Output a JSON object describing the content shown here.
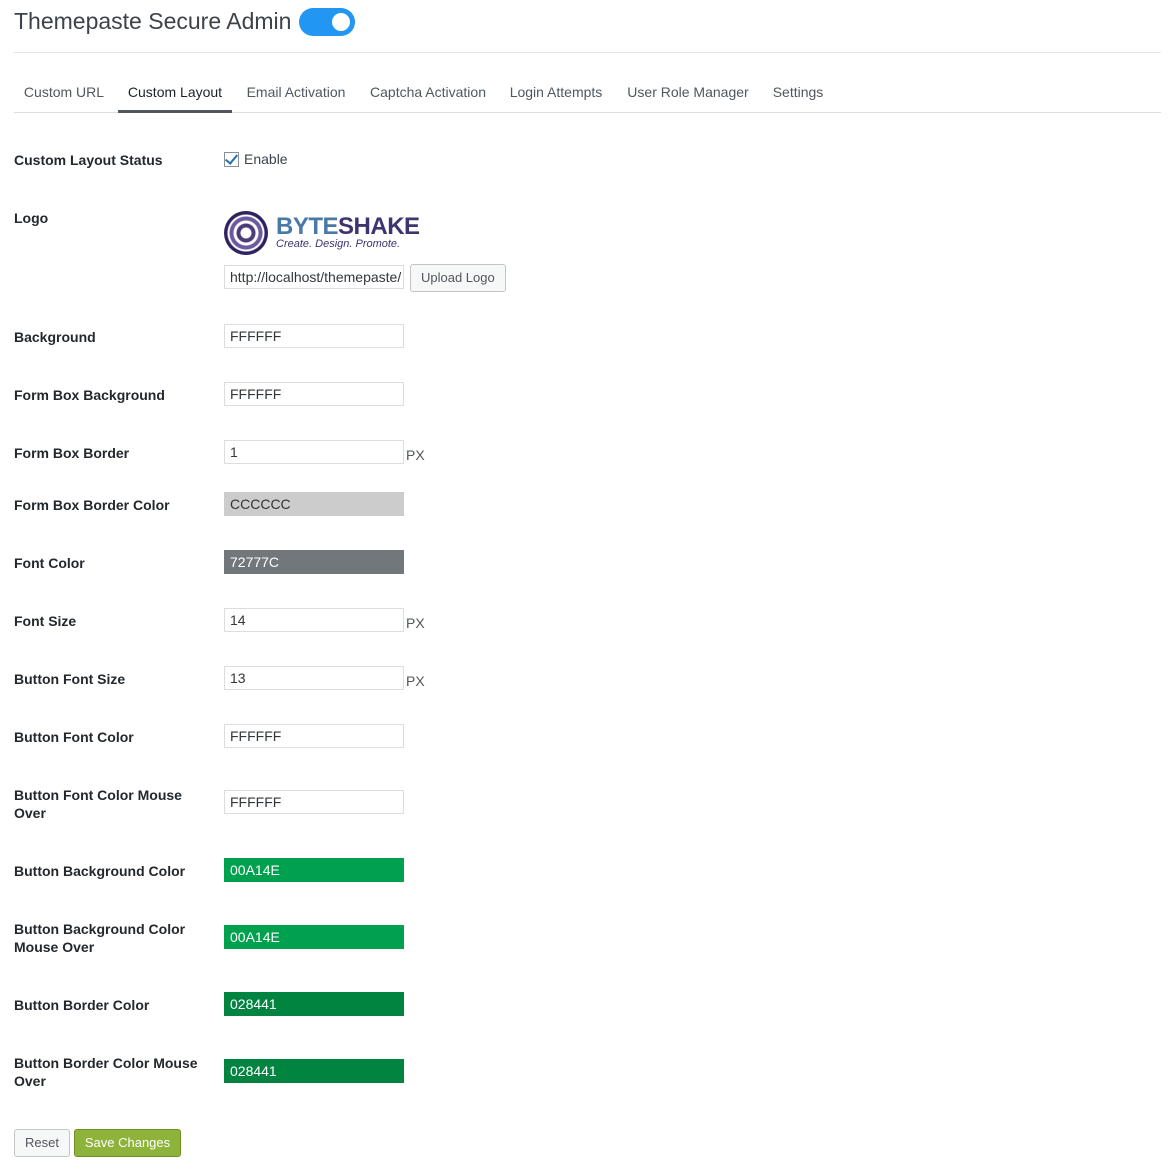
{
  "header": {
    "title": "Themepaste Secure Admin",
    "toggle_on": true
  },
  "tabs": [
    {
      "label": "Custom URL"
    },
    {
      "label": "Custom Layout",
      "active": true
    },
    {
      "label": "Email Activation"
    },
    {
      "label": "Captcha Activation"
    },
    {
      "label": "Login Attempts"
    },
    {
      "label": "User Role Manager"
    },
    {
      "label": "Settings"
    }
  ],
  "form": {
    "status": {
      "label": "Custom Layout Status",
      "checkbox_label": "Enable",
      "checked": true
    },
    "logo": {
      "label": "Logo",
      "brand_part1": "BYTE",
      "brand_part2": "SHAKE",
      "tagline": "Create.   Design.   Promote.",
      "url_value": "http://localhost/themepaste/",
      "upload_button": "Upload Logo"
    },
    "background": {
      "label": "Background",
      "value": "FFFFFF"
    },
    "form_box_background": {
      "label": "Form Box Background",
      "value": "FFFFFF"
    },
    "form_box_border": {
      "label": "Form Box Border",
      "value": "1",
      "unit": "PX"
    },
    "form_box_border_color": {
      "label": "Form Box Border Color",
      "value": "CCCCCC",
      "color": "#CCCCCC"
    },
    "font_color": {
      "label": "Font Color",
      "value": "72777C",
      "color": "#72777C"
    },
    "font_size": {
      "label": "Font Size",
      "value": "14",
      "unit": "PX"
    },
    "button_font_size": {
      "label": "Button Font Size",
      "value": "13",
      "unit": "PX"
    },
    "button_font_color": {
      "label": "Button Font Color",
      "value": "FFFFFF"
    },
    "button_font_color_hover": {
      "label": "Button Font Color Mouse Over",
      "value": "FFFFFF"
    },
    "button_bg_color": {
      "label": "Button Background Color",
      "value": "00A14E",
      "color": "#00A14E"
    },
    "button_bg_color_hover": {
      "label": "Button Background Color Mouse Over",
      "value": "00A14E",
      "color": "#00A14E"
    },
    "button_border_color": {
      "label": "Button Border Color",
      "value": "028441",
      "color": "#028441"
    },
    "button_border_color_hover": {
      "label": "Button Border Color Mouse Over",
      "value": "028441",
      "color": "#028441"
    }
  },
  "actions": {
    "reset": "Reset",
    "save": "Save Changes"
  },
  "colors": {
    "accent": "#2196F3",
    "primary_button": "#8DB33A"
  }
}
